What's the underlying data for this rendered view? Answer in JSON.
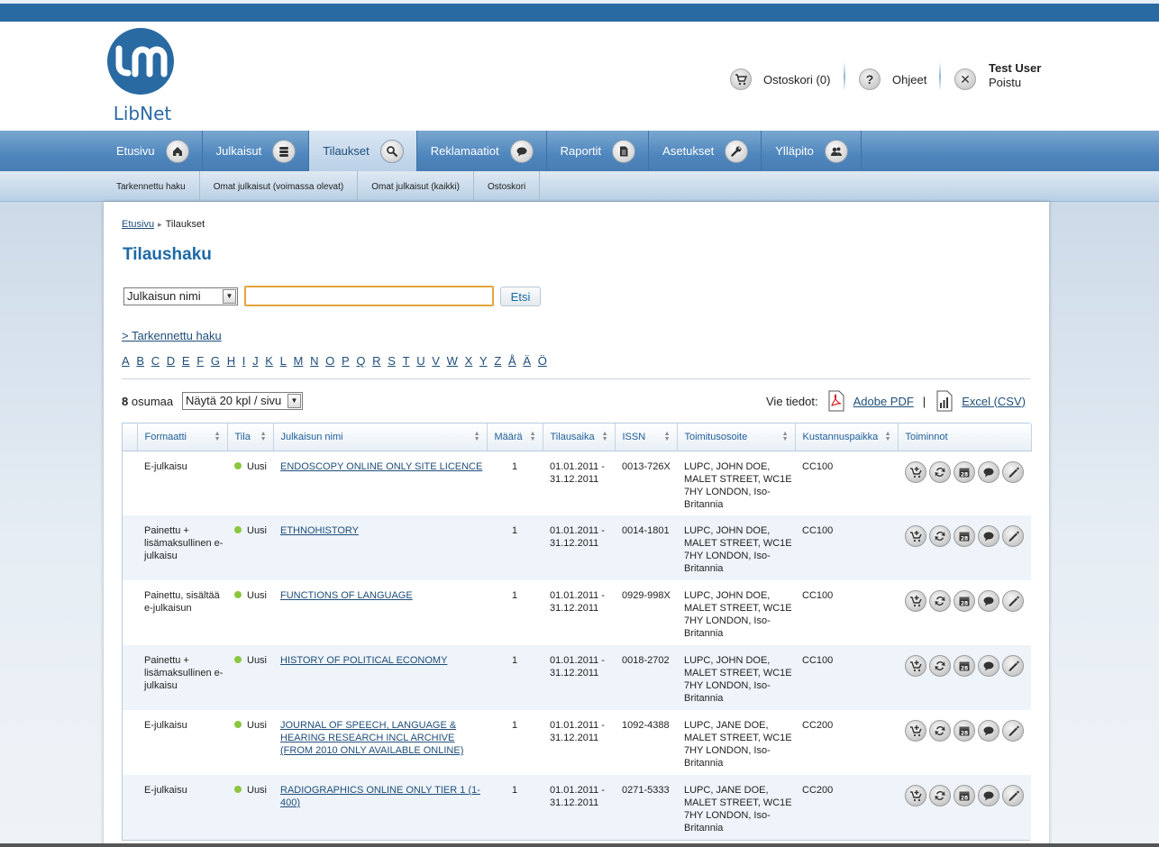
{
  "brand": {
    "name": "LibNet"
  },
  "header": {
    "cart": {
      "label": "Ostoskori (0)",
      "icon": "cart-icon"
    },
    "help": {
      "label": "Ohjeet",
      "icon": "question-icon"
    },
    "user": {
      "name": "Test User",
      "logout": "Poistu",
      "icon": "close-icon"
    }
  },
  "nav": {
    "items": [
      {
        "label": "Etusivu",
        "icon": "home-icon"
      },
      {
        "label": "Julkaisut",
        "icon": "stack-icon"
      },
      {
        "label": "Tilaukset",
        "icon": "search-icon"
      },
      {
        "label": "Reklamaatiot",
        "icon": "chat-icon"
      },
      {
        "label": "Raportit",
        "icon": "document-icon"
      },
      {
        "label": "Asetukset",
        "icon": "wrench-icon"
      },
      {
        "label": "Ylläpito",
        "icon": "users-icon"
      }
    ],
    "active_index": 2
  },
  "subnav": {
    "items": [
      "Tarkennettu haku",
      "Omat julkaisut (voimassa olevat)",
      "Omat julkaisut (kaikki)",
      "Ostoskori"
    ]
  },
  "breadcrumb": {
    "home": "Etusivu",
    "current": "Tilaukset"
  },
  "page": {
    "title": "Tilaushaku"
  },
  "search": {
    "field_selected": "Julkaisun nimi",
    "query_value": "",
    "button_label": "Etsi",
    "advanced_link": "> Tarkennettu haku"
  },
  "alphabet": [
    "A",
    "B",
    "C",
    "D",
    "E",
    "F",
    "G",
    "H",
    "I",
    "J",
    "K",
    "L",
    "M",
    "N",
    "O",
    "P",
    "Q",
    "R",
    "S",
    "T",
    "U",
    "V",
    "W",
    "X",
    "Y",
    "Z",
    "Å",
    "Ä",
    "Ö"
  ],
  "results": {
    "count": "8",
    "count_label": "osumaa",
    "per_page": "Näytä 20 kpl / sivu",
    "export_label": "Vie tiedot:",
    "export_pdf": "Adobe PDF",
    "export_sep": "|",
    "export_csv": "Excel (CSV)"
  },
  "table": {
    "columns": [
      "Formaatti",
      "Tila",
      "Julkaisun nimi",
      "Määrä",
      "Tilausaika",
      "ISSN",
      "Toimitusosoite",
      "Kustannuspaikka",
      "Toiminnot"
    ],
    "status_color": "#8cc63f",
    "rows": [
      {
        "format": "E-julkaisu",
        "status": "Uusi",
        "title": "ENDOSCOPY ONLINE ONLY SITE LICENCE",
        "qty": "1",
        "period": "01.01.2011 - 31.12.2011",
        "issn": "0013-726X",
        "address": "LUPC, JOHN DOE, MALET STREET, WC1E 7HY LONDON, Iso-Britannia",
        "cost": "CC100"
      },
      {
        "format": "Painettu + lisämaksullinen e-julkaisu",
        "status": "Uusi",
        "title": "ETHNOHISTORY",
        "qty": "1",
        "period": "01.01.2011 - 31.12.2011",
        "issn": "0014-1801",
        "address": "LUPC, JOHN DOE, MALET STREET, WC1E 7HY LONDON, Iso-Britannia",
        "cost": "CC100"
      },
      {
        "format": "Painettu, sisältää e-julkaisun",
        "status": "Uusi",
        "title": "FUNCTIONS OF LANGUAGE",
        "qty": "1",
        "period": "01.01.2011 - 31.12.2011",
        "issn": "0929-998X",
        "address": "LUPC, JOHN DOE, MALET STREET, WC1E 7HY LONDON, Iso-Britannia",
        "cost": "CC100"
      },
      {
        "format": "Painettu + lisämaksullinen e-julkaisu",
        "status": "Uusi",
        "title": "HISTORY OF POLITICAL ECONOMY",
        "qty": "1",
        "period": "01.01.2011 - 31.12.2011",
        "issn": "0018-2702",
        "address": "LUPC, JOHN DOE, MALET STREET, WC1E 7HY LONDON, Iso-Britannia",
        "cost": "CC100"
      },
      {
        "format": "E-julkaisu",
        "status": "Uusi",
        "title": "JOURNAL OF SPEECH, LANGUAGE & HEARING RESEARCH INCL ARCHIVE (FROM 2010 ONLY AVAILABLE ONLINE)",
        "qty": "1",
        "period": "01.01.2011 - 31.12.2011",
        "issn": "1092-4388",
        "address": "LUPC, JANE DOE, MALET STREET, WC1E 7HY LONDON, Iso-Britannia",
        "cost": "CC200"
      },
      {
        "format": "E-julkaisu",
        "status": "Uusi",
        "title": "RADIOGRAPHICS ONLINE ONLY TIER 1 (1-400)",
        "qty": "1",
        "period": "01.01.2011 - 31.12.2011",
        "issn": "0271-5333",
        "address": "LUPC, JANE DOE, MALET STREET, WC1E 7HY LONDON, Iso-Britannia",
        "cost": "CC200"
      }
    ],
    "row_actions": [
      "cart-add-icon",
      "renew-icon",
      "calendar-icon",
      "comment-icon",
      "edit-icon"
    ],
    "calendar_day": "28"
  }
}
